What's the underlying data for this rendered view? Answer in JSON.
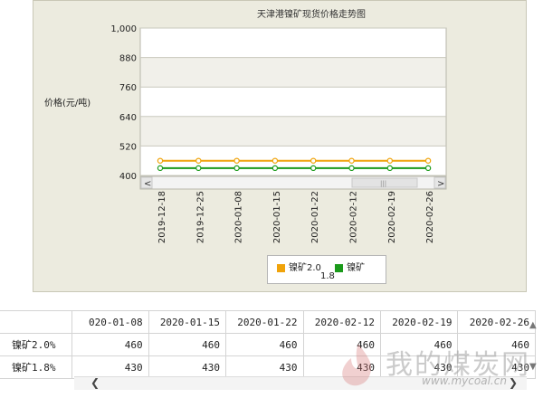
{
  "chart_data": {
    "type": "line",
    "title": "天津港镍矿现货价格走势图",
    "ylabel": "价格(元/吨)",
    "xlabel": "",
    "categories": [
      "2019-12-18",
      "2019-12-25",
      "2020-01-08",
      "2020-01-15",
      "2020-01-22",
      "2020-02-12",
      "2020-02-19",
      "2020-02-26"
    ],
    "series": [
      {
        "name": "镍矿2.0",
        "color": "#f0a30a",
        "values": [
          460,
          460,
          460,
          460,
          460,
          460,
          460,
          460
        ]
      },
      {
        "name": "镍矿1.8",
        "color": "#1a9a1a",
        "values": [
          430,
          430,
          430,
          430,
          430,
          430,
          430,
          430
        ]
      }
    ],
    "ylim": [
      400,
      1000
    ],
    "yticks": [
      "1,000",
      "880",
      "760",
      "640",
      "520",
      "400"
    ],
    "ytick_values": [
      1000,
      880,
      760,
      640,
      520,
      400
    ],
    "grid": true,
    "legend_position": "bottom"
  },
  "legend": {
    "item1": "镍矿2.0",
    "item2_main": "镍矿",
    "item2_wrap": "1.8"
  },
  "table": {
    "columns": [
      "020-01-08",
      "2020-01-15",
      "2020-01-22",
      "2020-02-12",
      "2020-02-19",
      "2020-02-26"
    ],
    "rows": [
      {
        "name": "镍矿2.0%",
        "values": [
          "460",
          "460",
          "460",
          "460",
          "460",
          "460"
        ]
      },
      {
        "name": "镍矿1.8%",
        "values": [
          "430",
          "430",
          "430",
          "430",
          "430",
          "430"
        ]
      }
    ]
  },
  "watermark": {
    "text": "我的煤炭网",
    "url": "www.mycoal.cn"
  },
  "icons": {
    "left_arrow": "chevron-left-icon",
    "right_arrow": "chevron-right-icon",
    "scroll_grip": "scroll-grip-icon"
  }
}
